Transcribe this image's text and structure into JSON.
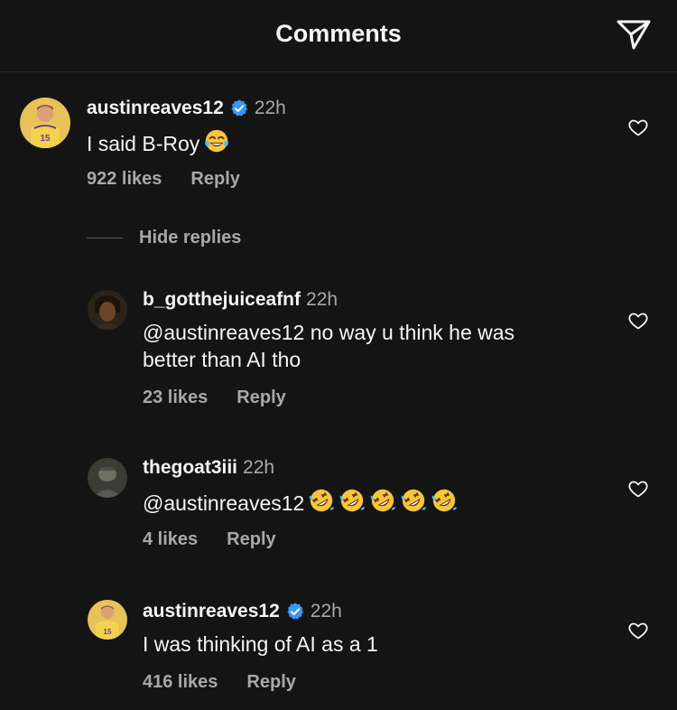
{
  "header": {
    "title": "Comments",
    "share_icon": "paper-plane-icon"
  },
  "comments": [
    {
      "username": "austinreaves12",
      "verified": true,
      "time": "22h",
      "text": "I said B-Roy",
      "emojis": [
        "face-with-tears-of-joy"
      ],
      "likes": "922 likes",
      "reply_label": "Reply"
    },
    {
      "username": "b_gotthejuiceafnf",
      "verified": false,
      "time": "22h",
      "text_line1": "@austinreaves12 no way u think he was",
      "text_line2": "better than AI tho",
      "likes": "23 likes",
      "reply_label": "Reply"
    },
    {
      "username": "thegoat3iii",
      "verified": false,
      "time": "22h",
      "text": "@austinreaves12",
      "emojis": [
        "rolling-on-floor-laughing",
        "rolling-on-floor-laughing",
        "rolling-on-floor-laughing",
        "rolling-on-floor-laughing",
        "rolling-on-floor-laughing"
      ],
      "likes": "4 likes",
      "reply_label": "Reply"
    },
    {
      "username": "austinreaves12",
      "verified": true,
      "time": "22h",
      "text": "I was thinking of AI as a 1",
      "likes": "416 likes",
      "reply_label": "Reply"
    }
  ],
  "thread": {
    "hide_replies_label": "Hide replies"
  },
  "colors": {
    "background": "#141414",
    "text": "#f5f5f5",
    "muted": "#a8a8a8",
    "verified": "#3897f0"
  }
}
